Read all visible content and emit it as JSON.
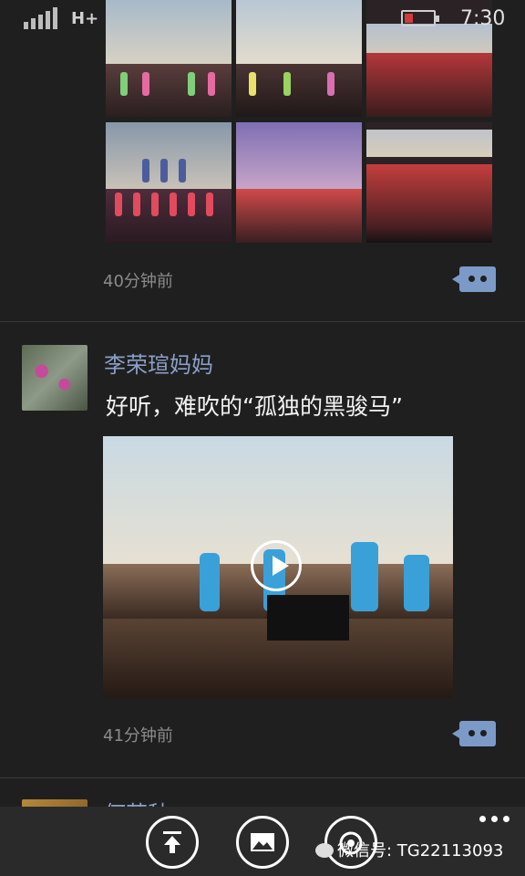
{
  "status_bar": {
    "network": "H+",
    "time": "7:30",
    "battery_level": 0.3,
    "battery_color": "#d13b3b"
  },
  "posts": [
    {
      "time_ago": "40分钟前"
    },
    {
      "username": "李荣瑄妈妈",
      "text": "好听，难吹的“孤独的黑骏马”",
      "time_ago": "41分钟前"
    },
    {
      "username": "何若秋"
    }
  ],
  "colors": {
    "background": "#1f1f1f",
    "username": "#8aa0c8",
    "comment_button": "#7b9ac7",
    "timestamp": "#8b8b8b"
  },
  "app_bar": {
    "buttons": [
      "upload-icon",
      "image-icon",
      "camera-icon"
    ],
    "more_icon": "more-icon",
    "watermark": "微信号: TG22113093"
  }
}
